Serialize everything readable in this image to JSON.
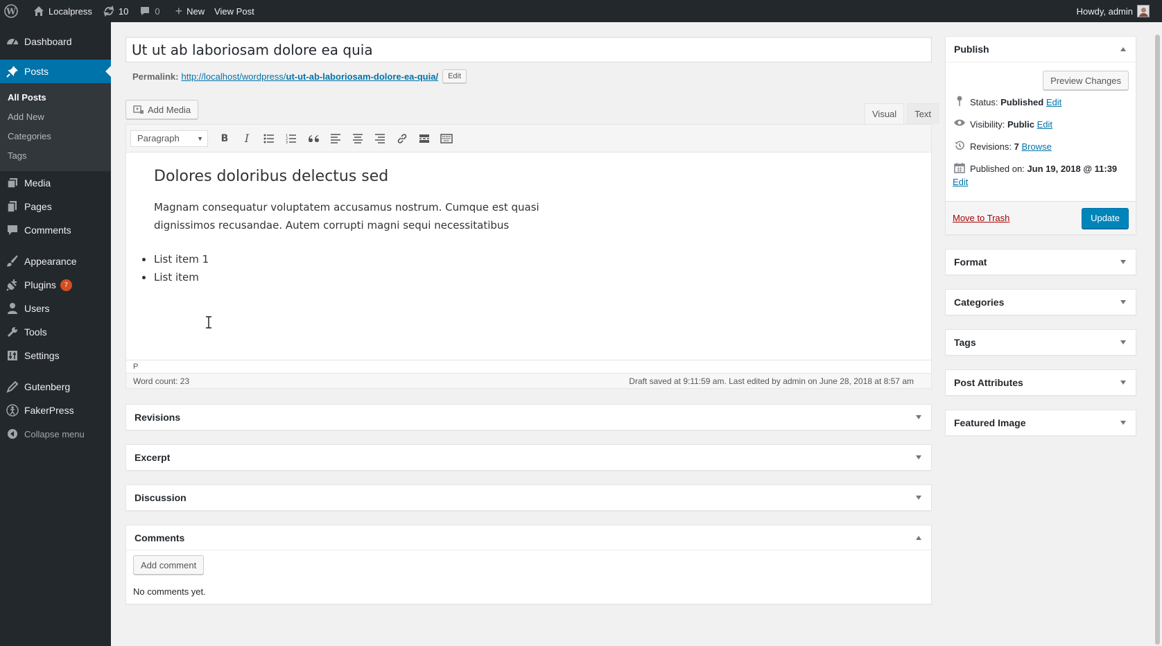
{
  "adminbar": {
    "site_name": "Localpress",
    "updates_count": "10",
    "comments_count": "0",
    "new_label": "New",
    "view_post_label": "View Post",
    "howdy": "Howdy, admin"
  },
  "sidebar": {
    "items": [
      {
        "label": "Dashboard"
      },
      {
        "label": "Posts"
      },
      {
        "label": "Media"
      },
      {
        "label": "Pages"
      },
      {
        "label": "Comments"
      },
      {
        "label": "Appearance"
      },
      {
        "label": "Plugins",
        "badge": "7"
      },
      {
        "label": "Users"
      },
      {
        "label": "Tools"
      },
      {
        "label": "Settings"
      },
      {
        "label": "Gutenberg"
      },
      {
        "label": "FakerPress"
      }
    ],
    "posts_submenu": [
      "All Posts",
      "Add New",
      "Categories",
      "Tags"
    ],
    "collapse_label": "Collapse menu"
  },
  "post": {
    "title": "Ut ut ab laboriosam dolore ea quia",
    "permalink_label": "Permalink:",
    "permalink_base": "http://localhost/wordpress/",
    "permalink_slug": "ut-ut-ab-laboriosam-dolore-ea-quia/",
    "permalink_edit": "Edit"
  },
  "editor": {
    "add_media": "Add Media",
    "tab_visual": "Visual",
    "tab_text": "Text",
    "format_select": "Paragraph",
    "heading": "Dolores doloribus delectus sed",
    "paragraph": "Magnam consequatur voluptatem accusamus nostrum. Cumque est quasi dignissimos recusandae. Autem corrupti magni sequi necessitatibus",
    "list_items": [
      "List item 1",
      "List item"
    ],
    "path": "P",
    "word_count": "Word count: 23",
    "draft_info": "Draft saved at 9:11:59 am. Last edited by admin on June 28, 2018 at 8:57 am"
  },
  "metaboxes": {
    "revisions": "Revisions",
    "excerpt": "Excerpt",
    "discussion": "Discussion",
    "comments": "Comments",
    "add_comment": "Add comment",
    "no_comments": "No comments yet."
  },
  "publish": {
    "title": "Publish",
    "preview": "Preview Changes",
    "status_label": "Status:",
    "status_value": "Published",
    "visibility_label": "Visibility:",
    "visibility_value": "Public",
    "revisions_label": "Revisions:",
    "revisions_value": "7",
    "browse": "Browse",
    "published_on_label": "Published on:",
    "published_on_value": "Jun 19, 2018 @ 11:39",
    "edit": "Edit",
    "trash": "Move to Trash",
    "update": "Update"
  },
  "side_boxes": {
    "format": "Format",
    "categories": "Categories",
    "tags": "Tags",
    "post_attributes": "Post Attributes",
    "featured_image": "Featured Image"
  },
  "colors": {
    "adminbar_bg": "#23282d",
    "accent": "#0073aa",
    "primary_button": "#0085ba",
    "badge": "#d54e21"
  }
}
